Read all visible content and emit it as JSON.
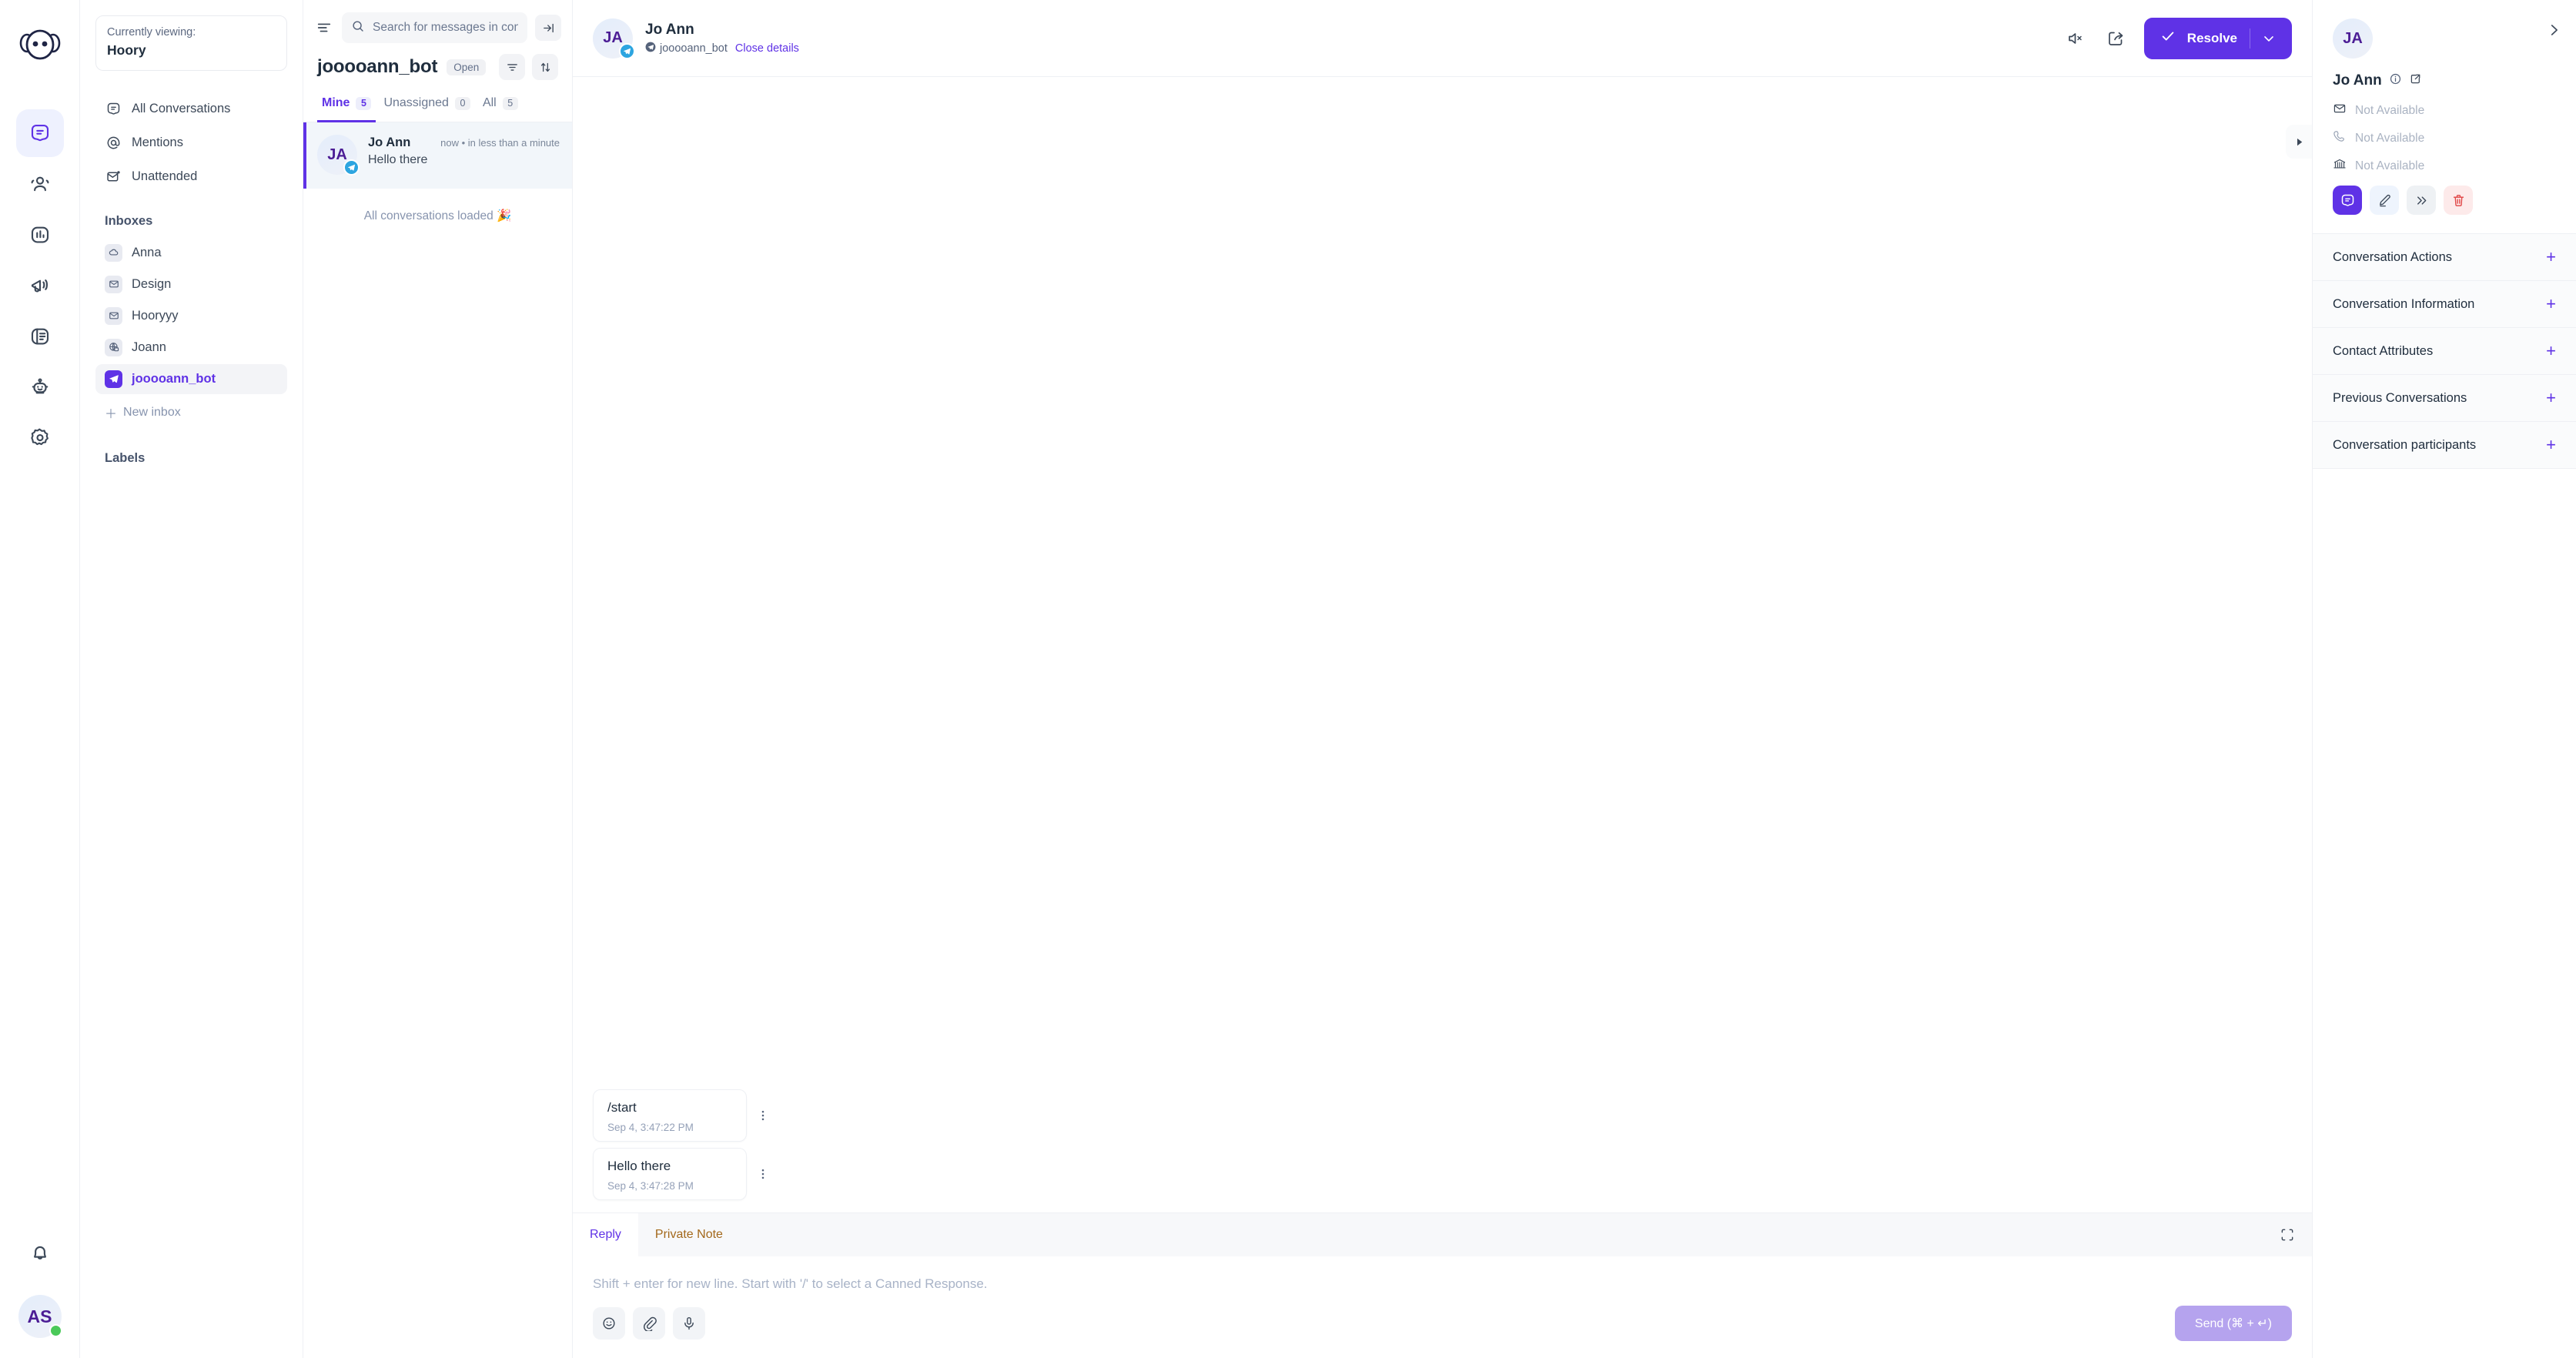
{
  "rail": {
    "logo_icon": "hoory-logo-icon",
    "nav": [
      {
        "name": "conversations",
        "icon": "conversations-icon",
        "active": true
      },
      {
        "name": "contacts",
        "icon": "contacts-icon",
        "active": false
      },
      {
        "name": "reports",
        "icon": "reports-bar-chart-icon",
        "active": false
      },
      {
        "name": "campaigns",
        "icon": "megaphone-icon",
        "active": false
      },
      {
        "name": "knowledge-base",
        "icon": "article-icon",
        "active": false
      },
      {
        "name": "bot",
        "icon": "robot-icon",
        "active": false
      },
      {
        "name": "settings",
        "icon": "gear-icon",
        "active": false
      }
    ],
    "notifications_icon": "bell-icon",
    "user_initials": "AS"
  },
  "sidebar": {
    "viewing_label": "Currently viewing:",
    "viewing_name": "Hoory",
    "nav_items": [
      {
        "label": "All Conversations",
        "icon": "conversations-icon"
      },
      {
        "label": "Mentions",
        "icon": "at-mention-icon"
      },
      {
        "label": "Unattended",
        "icon": "unattended-envelope-icon"
      }
    ],
    "inboxes_heading": "Inboxes",
    "inboxes": [
      {
        "label": "Anna",
        "icon": "cloud-icon",
        "active": false
      },
      {
        "label": "Design",
        "icon": "envelope-icon",
        "active": false
      },
      {
        "label": "Hooryyy",
        "icon": "envelope-icon",
        "active": false
      },
      {
        "label": "Joann",
        "icon": "globe-website-icon",
        "active": false
      },
      {
        "label": "jooooann_bot",
        "icon": "telegram-icon",
        "active": true
      }
    ],
    "new_inbox_label": "New inbox",
    "labels_heading": "Labels"
  },
  "conversation_list": {
    "menu_icon": "hamburger-menu-icon",
    "search_placeholder": "Search for messages in conversations",
    "search_value": "",
    "search_icon": "search-icon",
    "collapse_icon": "collapse-panel-icon",
    "title": "jooooann_bot",
    "status_chip": "Open",
    "filter_icon": "filter-icon",
    "sort_icon": "sort-icon",
    "tabs": [
      {
        "label": "Mine",
        "count": "5",
        "active": true
      },
      {
        "label": "Unassigned",
        "count": "0",
        "active": false
      },
      {
        "label": "All",
        "count": "5",
        "active": false
      }
    ],
    "items": [
      {
        "initials": "JA",
        "name": "Jo Ann",
        "snippet": "Hello there",
        "time": "now • in less than a minute",
        "channel_icon": "telegram-icon",
        "selected": true
      }
    ],
    "all_loaded": "All conversations loaded 🎉"
  },
  "chat": {
    "initials": "JA",
    "name": "Jo Ann",
    "inbox_name": "jooooann_bot",
    "inbox_icon": "telegram-icon",
    "close_details": "Close details",
    "mute_icon": "mute-speaker-icon",
    "share_icon": "share-export-icon",
    "resolve_label": "Resolve",
    "resolve_check_icon": "check-icon",
    "resolve_caret_icon": "chevron-down-icon",
    "expand_icon": "expand-triangle-icon",
    "messages": [
      {
        "text": "/start",
        "time": "Sep 4, 3:47:22 PM",
        "menu_icon": "more-vertical-icon"
      },
      {
        "text": "Hello there",
        "time": "Sep 4, 3:47:28 PM",
        "menu_icon": "more-vertical-icon"
      }
    ]
  },
  "composer": {
    "tabs": [
      {
        "label": "Reply",
        "active": true
      },
      {
        "label": "Private Note",
        "active": false
      }
    ],
    "expand_icon": "expand-editor-icon",
    "placeholder": "Shift + enter for new line. Start with '/' to select a Canned Response.",
    "tools": [
      {
        "name": "emoji-icon"
      },
      {
        "name": "attachment-paperclip-icon"
      },
      {
        "name": "microphone-icon"
      }
    ],
    "send_label": "Send (⌘ + ↵)"
  },
  "right_panel": {
    "collapse_icon": "chevron-right-icon",
    "initials": "JA",
    "contact_name": "Jo Ann",
    "info_icon": "info-circle-icon",
    "external_icon": "external-link-icon",
    "fields": [
      {
        "icon": "envelope-icon",
        "value": "Not Available"
      },
      {
        "icon": "phone-icon",
        "value": "Not Available"
      },
      {
        "icon": "company-bank-icon",
        "value": "Not Available"
      }
    ],
    "actions": [
      {
        "name": "conversation-icon",
        "style": "primary"
      },
      {
        "name": "edit-pencil-icon",
        "style": "light"
      },
      {
        "name": "merge-arrows-icon",
        "style": "grey"
      },
      {
        "name": "delete-trash-icon",
        "style": "danger"
      }
    ],
    "sections": [
      {
        "label": "Conversation Actions",
        "toggle": "+"
      },
      {
        "label": "Conversation Information",
        "toggle": "+"
      },
      {
        "label": "Contact Attributes",
        "toggle": "+"
      },
      {
        "label": "Previous Conversations",
        "toggle": "+"
      },
      {
        "label": "Conversation participants",
        "toggle": "+"
      }
    ]
  },
  "colors": {
    "accent": "#5f32e6",
    "note_amber": "#a3681b",
    "danger": "#e04444",
    "online": "#4ac959",
    "telegram": "#2da5e0"
  }
}
